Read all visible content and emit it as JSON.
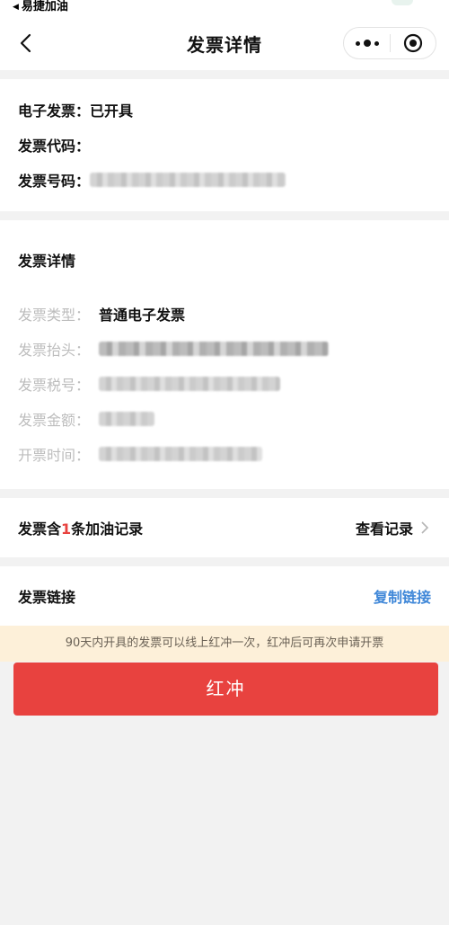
{
  "status_bar": {
    "back_label": "易捷加油"
  },
  "nav": {
    "title": "发票详情"
  },
  "invoice_status": {
    "type_label": "电子发票：",
    "type_value": "已开具",
    "code_label": "发票代码：",
    "code_value": "",
    "number_label": "发票号码："
  },
  "details": {
    "heading": "发票详情",
    "fields": [
      {
        "label": "发票类型：",
        "value": "普通电子发票"
      },
      {
        "label": "发票抬头：",
        "value": ""
      },
      {
        "label": "发票税号：",
        "value": ""
      },
      {
        "label": "发票金额：",
        "value": ""
      },
      {
        "label": "开票时间：",
        "value": ""
      }
    ]
  },
  "records": {
    "prefix": "发票含",
    "count": "1",
    "suffix": "条加油记录",
    "link": "查看记录"
  },
  "invoice_link": {
    "label": "发票链接",
    "copy": "复制链接"
  },
  "notice": "90天内开具的发票可以线上红冲一次，红冲后可再次申请开票",
  "action": {
    "red_flush": "红冲"
  },
  "colors": {
    "accent_red": "#e8423f",
    "link_blue": "#3f87d8",
    "notice_bg": "#fdf0d9"
  }
}
